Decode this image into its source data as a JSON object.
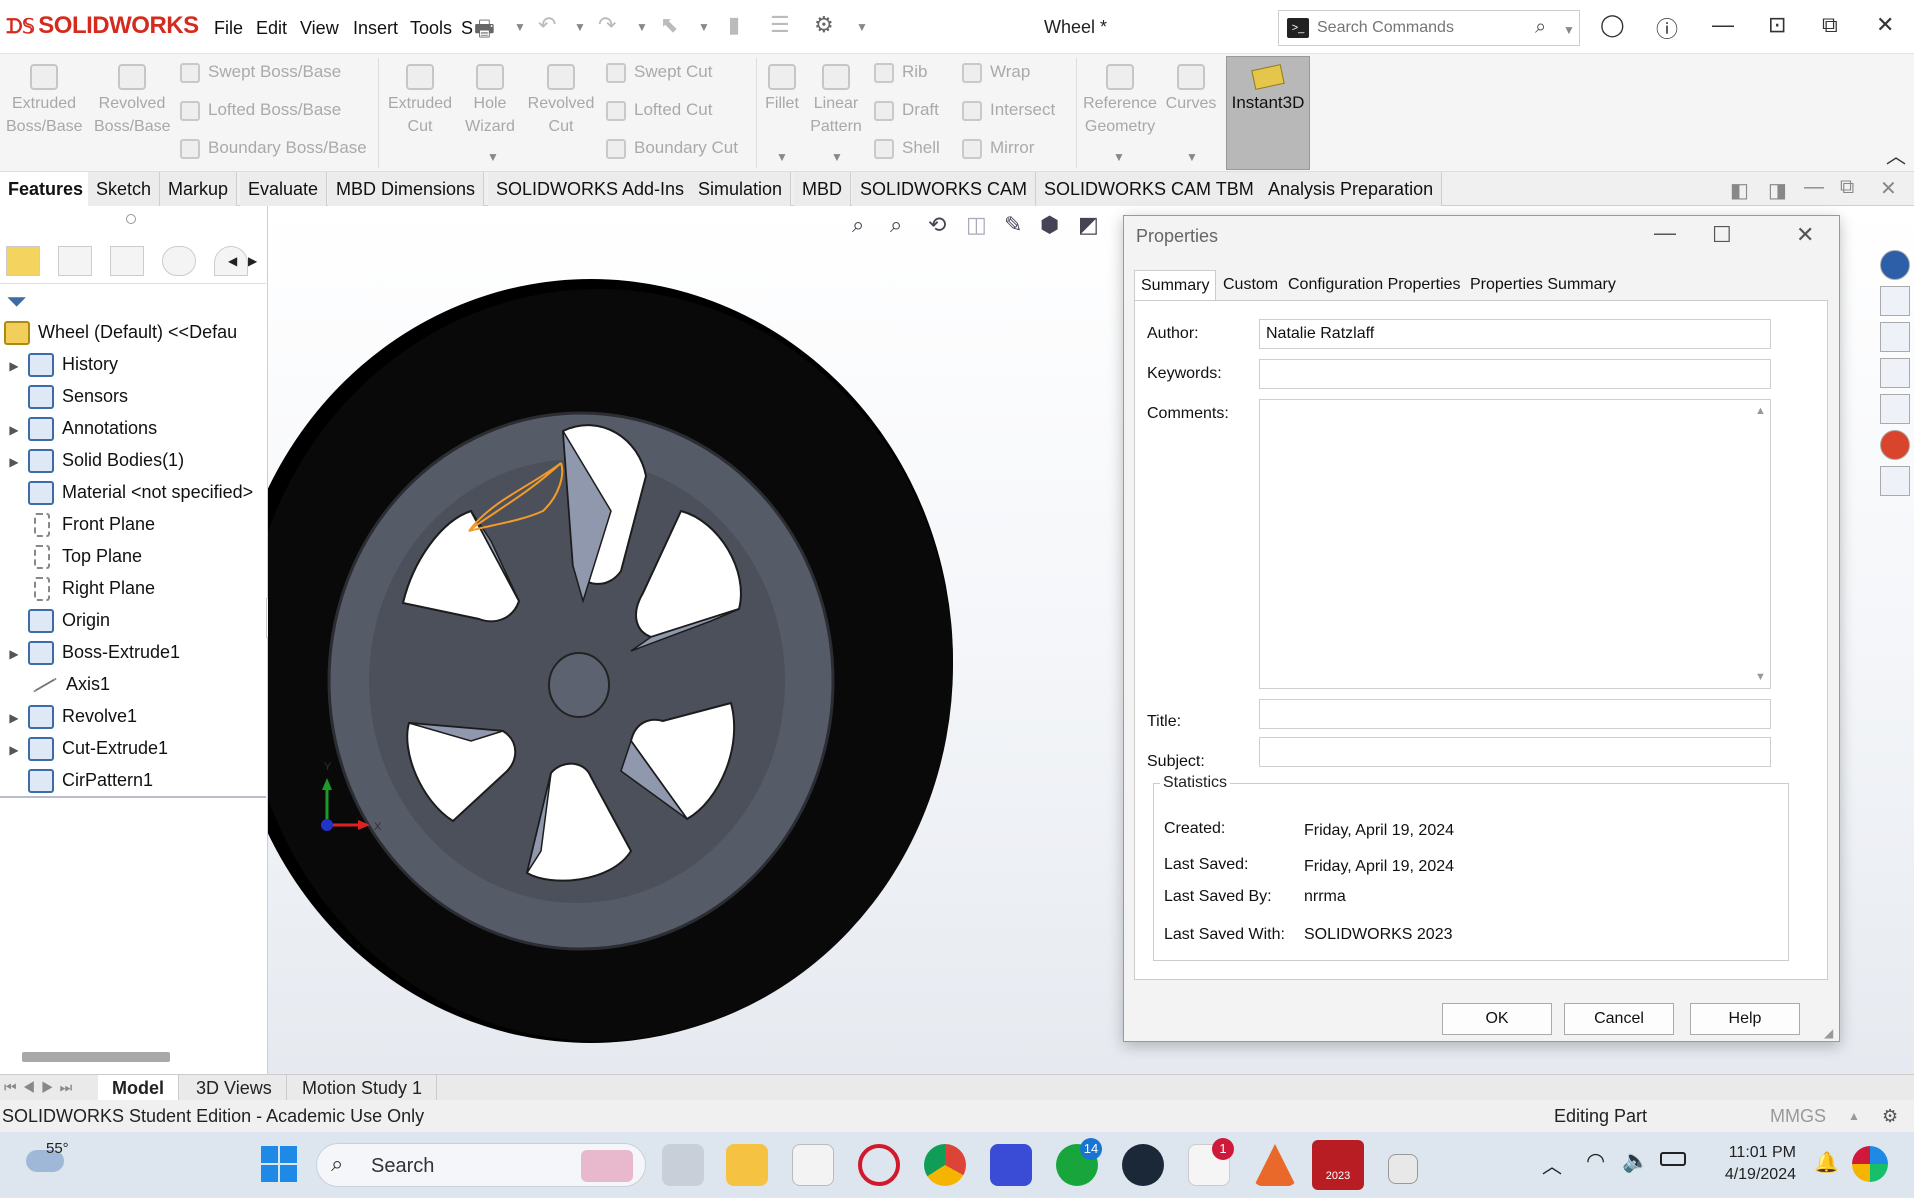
{
  "app": {
    "brand": "SOLIDWORKS",
    "brand_color": "#d52b1e",
    "document_title": "Wheel *",
    "menu": [
      "File",
      "Edit",
      "View",
      "Insert",
      "Tools"
    ],
    "menu_truncated": "S",
    "search": {
      "placeholder": "Search Commands"
    }
  },
  "ribbon": {
    "extruded_boss": "Extruded\nBoss/Base",
    "revolved_boss": "Revolved\nBoss/Base",
    "swept_boss": "Swept Boss/Base",
    "lofted_boss": "Lofted Boss/Base",
    "boundary_boss": "Boundary Boss/Base",
    "extruded_cut": "Extruded\nCut",
    "hole_wizard": "Hole\nWizard",
    "revolved_cut": "Revolved\nCut",
    "swept_cut": "Swept Cut",
    "lofted_cut": "Lofted Cut",
    "boundary_cut": "Boundary Cut",
    "fillet": "Fillet",
    "linear_pattern": "Linear\nPattern",
    "rib": "Rib",
    "draft": "Draft",
    "shell": "Shell",
    "wrap": "Wrap",
    "intersect": "Intersect",
    "mirror": "Mirror",
    "reference_geometry": "Reference\nGeometry",
    "curves": "Curves",
    "instant3d": "Instant3D"
  },
  "tabs": [
    "Features",
    "Sketch",
    "Markup",
    "Evaluate",
    "MBD Dimensions",
    "SOLIDWORKS Add-Ins",
    "Simulation",
    "MBD",
    "SOLIDWORKS CAM",
    "SOLIDWORKS CAM TBM",
    "Analysis Preparation"
  ],
  "tree": {
    "root": "Wheel (Default) <<Defau",
    "items": [
      {
        "label": "History",
        "expandable": true
      },
      {
        "label": "Sensors",
        "expandable": false
      },
      {
        "label": "Annotations",
        "expandable": true
      },
      {
        "label": "Solid Bodies(1)",
        "expandable": true
      },
      {
        "label": "Material <not specified>",
        "expandable": false
      },
      {
        "label": "Front Plane",
        "expandable": false
      },
      {
        "label": "Top Plane",
        "expandable": false
      },
      {
        "label": "Right Plane",
        "expandable": false
      },
      {
        "label": "Origin",
        "expandable": false
      },
      {
        "label": "Boss-Extrude1",
        "expandable": true
      },
      {
        "label": "Axis1",
        "expandable": false
      },
      {
        "label": "Revolve1",
        "expandable": true
      },
      {
        "label": "Cut-Extrude1",
        "expandable": true
      },
      {
        "label": "CirPattern1",
        "expandable": false
      }
    ]
  },
  "triad": {
    "x": "X",
    "y": "Y"
  },
  "dialog": {
    "title": "Properties",
    "tabs": [
      "Summary",
      "Custom",
      "Configuration Properties",
      "Properties Summary"
    ],
    "author_label": "Author:",
    "author": "Natalie Ratzlaff",
    "keywords_label": "Keywords:",
    "keywords": "",
    "comments_label": "Comments:",
    "comments": "",
    "title_label": "Title:",
    "title_value": "",
    "subject_label": "Subject:",
    "subject": "",
    "statistics": {
      "legend": "Statistics",
      "created_label": "Created:",
      "created": "Friday, April 19, 2024",
      "last_saved_label": "Last Saved:",
      "last_saved": "Friday, April 19, 2024",
      "last_saved_by_label": "Last Saved By:",
      "last_saved_by": "nrrma",
      "last_saved_with_label": "Last Saved With:",
      "last_saved_with": "SOLIDWORKS 2023"
    },
    "ok": "OK",
    "cancel": "Cancel",
    "help": "Help"
  },
  "bottom_tabs": [
    "Model",
    "3D Views",
    "Motion Study 1"
  ],
  "status": {
    "left": "SOLIDWORKS Student Edition - Academic Use Only",
    "mode": "Editing Part",
    "units": "MMGS"
  },
  "taskbar": {
    "weather": "55°",
    "search": "Search",
    "xbox_badge": "14",
    "slack_badge": "1",
    "sw_badge": "2023",
    "time": "11:01 PM",
    "date": "4/19/2024"
  }
}
